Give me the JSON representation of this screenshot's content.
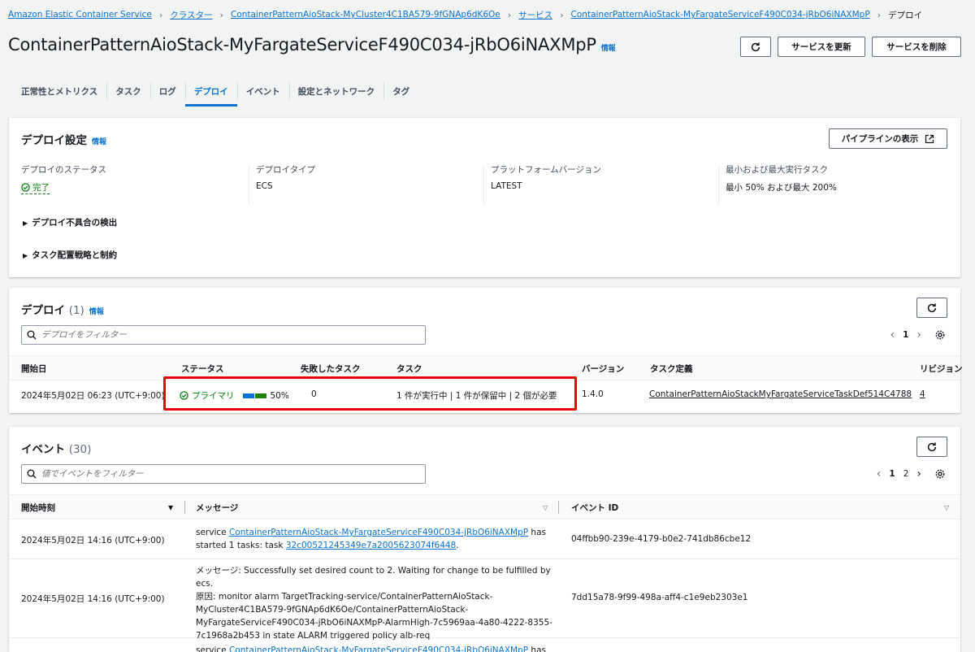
{
  "breadcrumb": {
    "items": [
      "Amazon Elastic Container Service",
      "クラスター",
      "ContainerPatternAioStack-MyCluster4C1BA579-9fGNAp6dK6Oe",
      "サービス",
      "ContainerPatternAioStack-MyFargateServiceF490C034-jRbO6iNAXMpP"
    ],
    "current": "デプロイ"
  },
  "header": {
    "title": "ContainerPatternAioStack-MyFargateServiceF490C034-jRbO6iNAXMpP",
    "info": "情報",
    "update_label": "サービスを更新",
    "delete_label": "サービスを削除"
  },
  "tabs": [
    "正常性とメトリクス",
    "タスク",
    "ログ",
    "デプロイ",
    "イベント",
    "設定とネットワーク",
    "タグ"
  ],
  "deploy_settings": {
    "title": "デプロイ設定",
    "info": "情報",
    "pipeline_label": "パイプラインの表示",
    "fields": [
      {
        "label": "デプロイのステータス",
        "value": "完了"
      },
      {
        "label": "デプロイタイプ",
        "value": "ECS"
      },
      {
        "label": "プラットフォームバージョン",
        "value": "LATEST"
      },
      {
        "label": "最小および最大実行タスク",
        "value": "最小 50% および最大 200%"
      }
    ],
    "expanders": [
      "デプロイ不具合の検出",
      "タスク配置戦略と制約"
    ]
  },
  "deployments": {
    "title": "デプロイ",
    "count": "(1)",
    "info": "情報",
    "filter_placeholder": "デプロイをフィルター",
    "page": "1",
    "columns": [
      "開始日",
      "ステータス",
      "失敗したタスク",
      "タスク",
      "バージョン",
      "タスク定義",
      "リビジョン"
    ],
    "row": {
      "start": "2024年5月02日 06:23 (UTC+9:00)",
      "status": "プライマリ",
      "progress": "50%",
      "progress_fraction": 0.5,
      "failed": "0",
      "tasks": "1 件が実行中 | 1 件が保留中 | 2 個が必要",
      "version": "1.4.0",
      "task_def": "ContainerPatternAioStackMyFargateServiceTaskDef514C4788",
      "revision": "4"
    }
  },
  "events": {
    "title": "イベント",
    "count": "(30)",
    "filter_placeholder": "値でイベントをフィルター",
    "pages": [
      "1",
      "2"
    ],
    "columns": [
      "開始時刻",
      "メッセージ",
      "イベント ID"
    ],
    "rows": [
      {
        "time": "2024年5月02日 14:16 (UTC+9:00)",
        "msg_prefix": "service ",
        "msg_link": "ContainerPatternAioStack-MyFargateServiceF490C034-jRbO6iNAXMpP",
        "msg_mid": " has started 1 tasks: task ",
        "msg_link2": "32c00521245349e7a2005623074f6448",
        "msg_suffix": ".",
        "id": "04ffbb90-239e-4179-b0e2-741db86cbe12"
      },
      {
        "time": "2024年5月02日 14:16 (UTC+9:00)",
        "msg_lines": [
          "メッセージ: Successfully set desired count to 2. Waiting for change to be fulfilled by ecs.",
          "原因: monitor alarm TargetTracking-service/ContainerPatternAioStack-",
          "MyCluster4C1BA579-9fGNAp6dK6Oe/ContainerPatternAioStack-",
          "MyFargateServiceF490C034-jRbO6iNAXMpP-AlarmHigh-7c5969aa-4a80-4222-8355-",
          "7c1968a2b453 in state ALARM triggered policy alb-req"
        ],
        "id": "7dd15a78-9f99-498a-aff4-c1e9eb2303e1"
      },
      {
        "msg_prefix": "service ",
        "msg_link": "ContainerPatternAioStack-MyFargateServiceF490C034-jRbO6iNAXMpP",
        "msg_mid": " has"
      }
    ]
  },
  "colors": {
    "link": "#0972d3",
    "success": "#037f0c",
    "highlight": "#e8000b",
    "bar_blue": "#0972d3",
    "bar_green": "#1d8102"
  }
}
